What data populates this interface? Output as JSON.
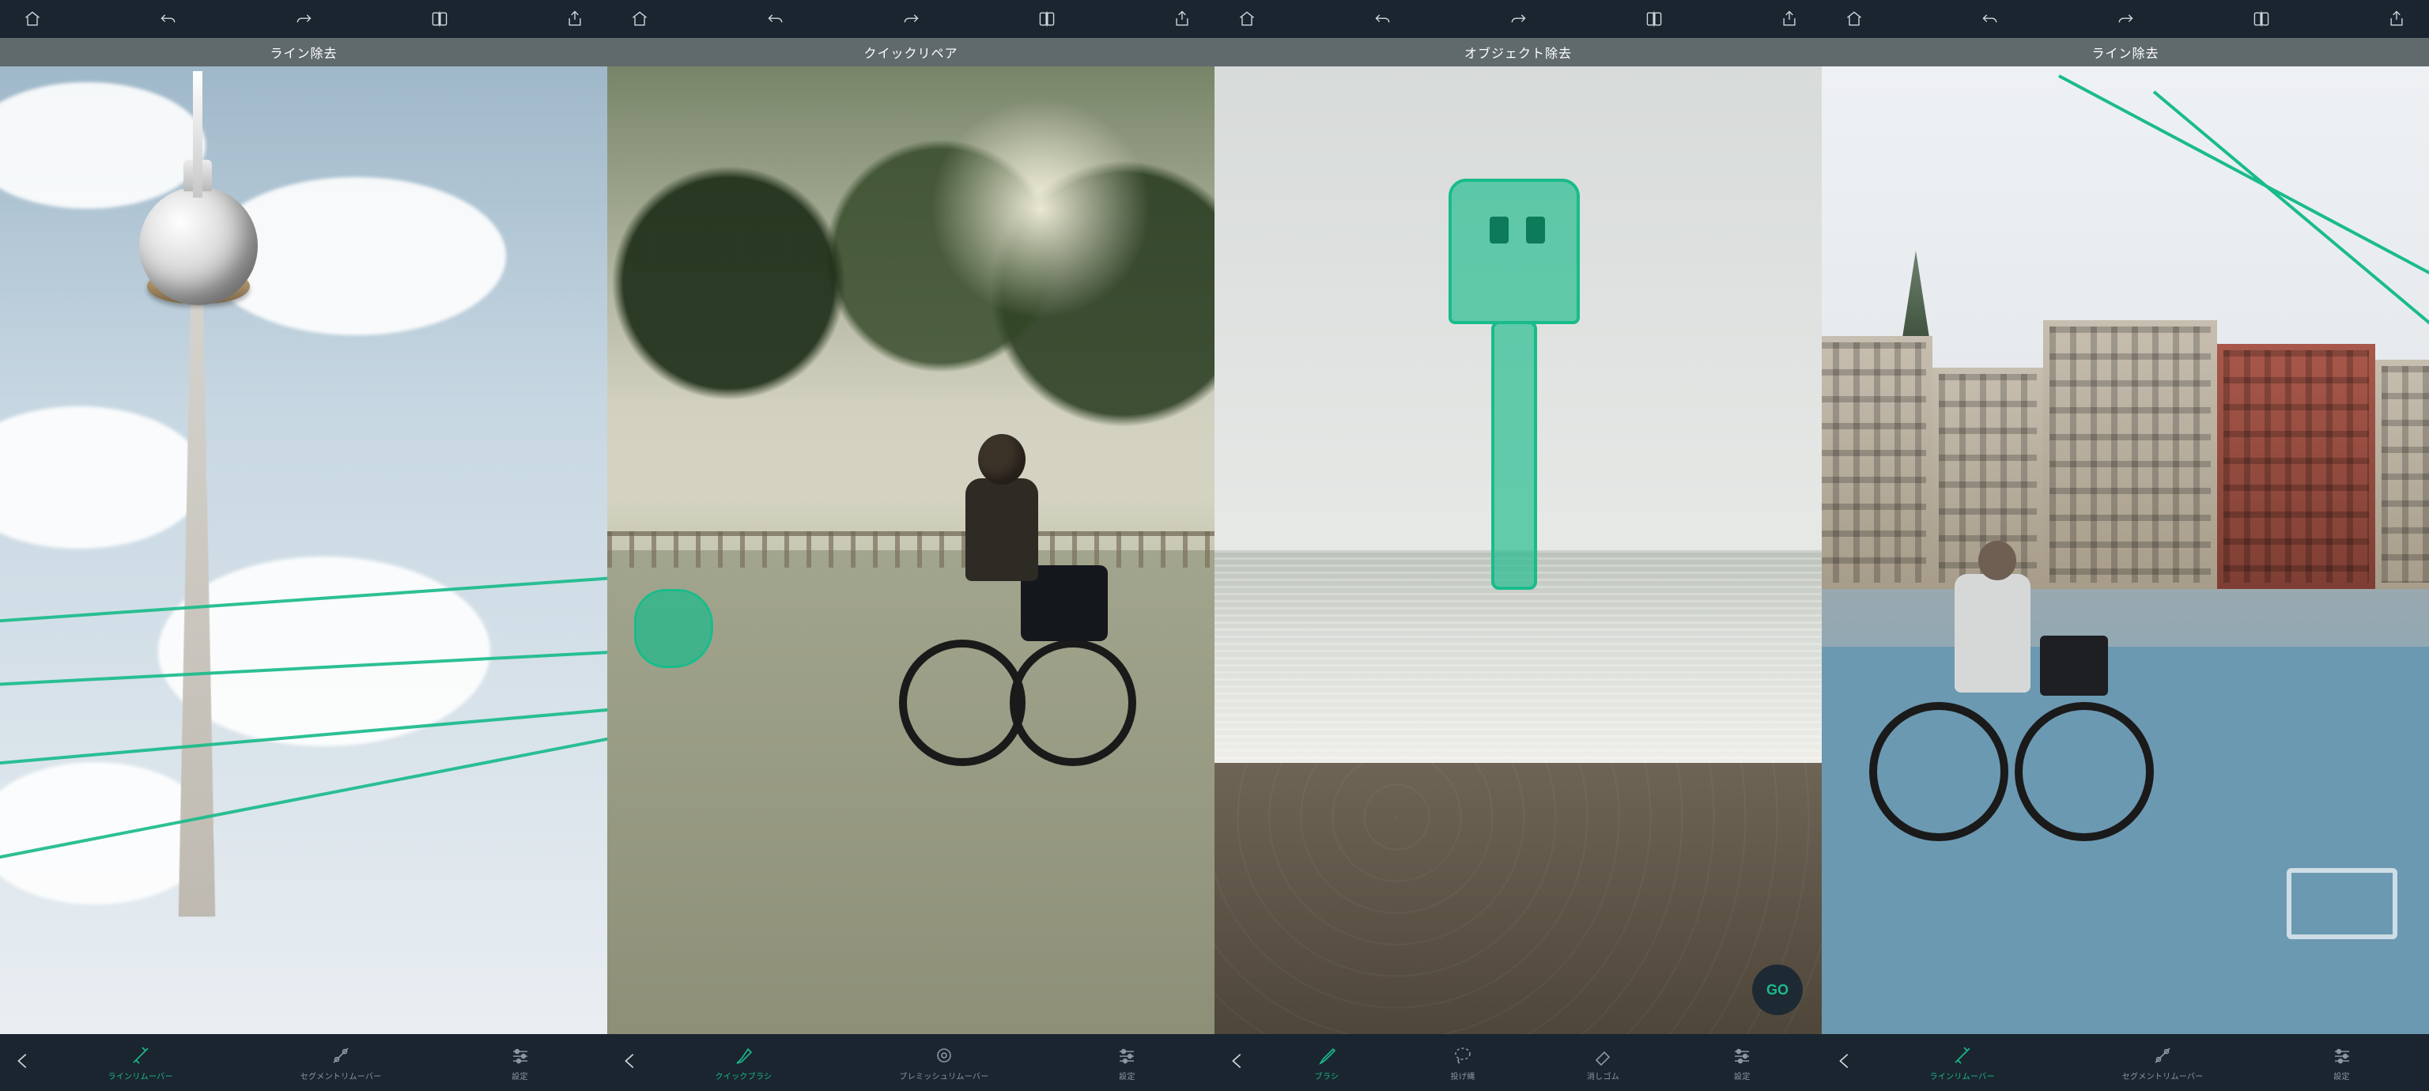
{
  "accent": "#1abb8b",
  "topbar_icons": [
    "home-icon",
    "undo-icon",
    "redo-icon",
    "compare-icon",
    "share-icon"
  ],
  "panels": [
    {
      "mode_label": "ライン除去",
      "bottom": {
        "tools": [
          {
            "label": "ラインリムーバー",
            "icon": "line-remover-icon",
            "active": true
          },
          {
            "label": "セグメントリムーバー",
            "icon": "segment-remover-icon",
            "active": false
          },
          {
            "label": "設定",
            "icon": "settings-icon",
            "active": false
          }
        ]
      }
    },
    {
      "mode_label": "クイックリペア",
      "bottom": {
        "tools": [
          {
            "label": "クイックブラシ",
            "icon": "quick-brush-icon",
            "active": true
          },
          {
            "label": "ブレミッシュリムーバー",
            "icon": "blemish-remover-icon",
            "active": false
          },
          {
            "label": "設定",
            "icon": "settings-icon",
            "active": false
          }
        ]
      }
    },
    {
      "mode_label": "オブジェクト除去",
      "go_label": "GO",
      "bottom": {
        "tools": [
          {
            "label": "ブラシ",
            "icon": "brush-icon",
            "active": true
          },
          {
            "label": "投げ縄",
            "icon": "lasso-icon",
            "active": false
          },
          {
            "label": "消しゴム",
            "icon": "eraser-icon",
            "active": false
          },
          {
            "label": "設定",
            "icon": "settings-icon",
            "active": false
          }
        ]
      }
    },
    {
      "mode_label": "ライン除去",
      "bottom": {
        "tools": [
          {
            "label": "ラインリムーバー",
            "icon": "line-remover-icon",
            "active": true
          },
          {
            "label": "セグメントリムーバー",
            "icon": "segment-remover-icon",
            "active": false
          },
          {
            "label": "設定",
            "icon": "settings-icon",
            "active": false
          }
        ]
      }
    }
  ]
}
